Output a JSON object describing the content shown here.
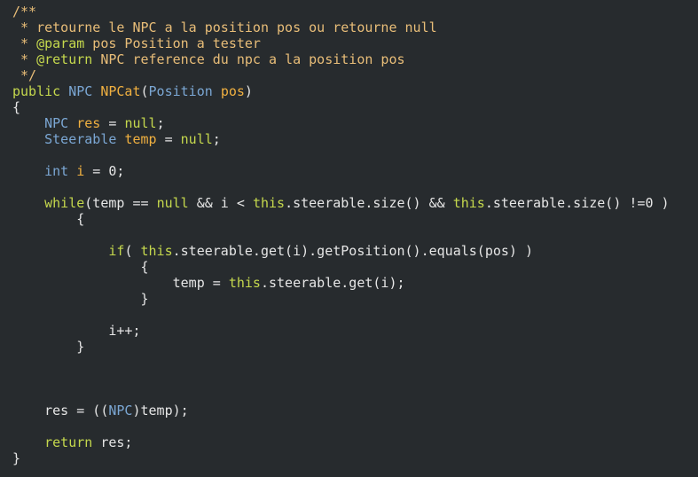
{
  "colors": {
    "background": "#272b2e",
    "default": "#e6e6e6",
    "comment": "#e8bd78",
    "keyword": "#c5d84d",
    "type": "#7ba7d4",
    "variable": "#f0b040"
  },
  "lines": [
    {
      "row": 0,
      "tokens": [
        {
          "t": "/**",
          "k": "comment"
        }
      ]
    },
    {
      "row": 1,
      "tokens": [
        {
          "t": " * retourne le NPC a la position pos ou retourne null",
          "k": "comment"
        }
      ]
    },
    {
      "row": 2,
      "tokens": [
        {
          "t": " * ",
          "k": "comment"
        },
        {
          "t": "@param",
          "k": "keyword"
        },
        {
          "t": " pos Position a tester",
          "k": "comment"
        }
      ]
    },
    {
      "row": 3,
      "tokens": [
        {
          "t": " * ",
          "k": "comment"
        },
        {
          "t": "@return",
          "k": "keyword"
        },
        {
          "t": " NPC reference du npc a la position pos",
          "k": "comment"
        }
      ]
    },
    {
      "row": 4,
      "tokens": [
        {
          "t": " */",
          "k": "comment"
        }
      ]
    },
    {
      "row": 5,
      "tokens": [
        {
          "t": "public",
          "k": "keyword"
        },
        {
          "t": " ",
          "k": "default"
        },
        {
          "t": "NPC",
          "k": "type"
        },
        {
          "t": " ",
          "k": "default"
        },
        {
          "t": "NPCat",
          "k": "variable"
        },
        {
          "t": "(",
          "k": "default"
        },
        {
          "t": "Position",
          "k": "type"
        },
        {
          "t": " ",
          "k": "default"
        },
        {
          "t": "pos",
          "k": "variable"
        },
        {
          "t": ")",
          "k": "default"
        }
      ]
    },
    {
      "row": 6,
      "tokens": [
        {
          "t": "{",
          "k": "default"
        }
      ]
    },
    {
      "row": 7,
      "tokens": [
        {
          "t": "    ",
          "k": "default"
        },
        {
          "t": "NPC",
          "k": "type"
        },
        {
          "t": " ",
          "k": "default"
        },
        {
          "t": "res",
          "k": "variable"
        },
        {
          "t": " = ",
          "k": "default"
        },
        {
          "t": "null",
          "k": "keyword"
        },
        {
          "t": ";",
          "k": "default"
        }
      ]
    },
    {
      "row": 8,
      "tokens": [
        {
          "t": "    ",
          "k": "default"
        },
        {
          "t": "Steerable",
          "k": "type"
        },
        {
          "t": " ",
          "k": "default"
        },
        {
          "t": "temp",
          "k": "variable"
        },
        {
          "t": " = ",
          "k": "default"
        },
        {
          "t": "null",
          "k": "keyword"
        },
        {
          "t": ";",
          "k": "default"
        }
      ]
    },
    {
      "row": 10,
      "tokens": [
        {
          "t": "    ",
          "k": "default"
        },
        {
          "t": "int",
          "k": "type"
        },
        {
          "t": " ",
          "k": "default"
        },
        {
          "t": "i",
          "k": "variable"
        },
        {
          "t": " = 0;",
          "k": "default"
        }
      ]
    },
    {
      "row": 12,
      "tokens": [
        {
          "t": "    ",
          "k": "default"
        },
        {
          "t": "while",
          "k": "keyword"
        },
        {
          "t": "(temp == ",
          "k": "default"
        },
        {
          "t": "null",
          "k": "keyword"
        },
        {
          "t": " && i < ",
          "k": "default"
        },
        {
          "t": "this",
          "k": "keyword"
        },
        {
          "t": ".steerable.size() && ",
          "k": "default"
        },
        {
          "t": "this",
          "k": "keyword"
        },
        {
          "t": ".steerable.size() !=0 )",
          "k": "default"
        }
      ]
    },
    {
      "row": 13,
      "tokens": [
        {
          "t": "        {",
          "k": "default"
        }
      ]
    },
    {
      "row": 15,
      "tokens": [
        {
          "t": "            ",
          "k": "default"
        },
        {
          "t": "if",
          "k": "keyword"
        },
        {
          "t": "( ",
          "k": "default"
        },
        {
          "t": "this",
          "k": "keyword"
        },
        {
          "t": ".steerable.get(i).getPosition().equals(pos) )",
          "k": "default"
        }
      ]
    },
    {
      "row": 16,
      "tokens": [
        {
          "t": "                {",
          "k": "default"
        }
      ]
    },
    {
      "row": 17,
      "tokens": [
        {
          "t": "                    temp = ",
          "k": "default"
        },
        {
          "t": "this",
          "k": "keyword"
        },
        {
          "t": ".steerable.get(i);",
          "k": "default"
        }
      ]
    },
    {
      "row": 18,
      "tokens": [
        {
          "t": "                }",
          "k": "default"
        }
      ]
    },
    {
      "row": 20,
      "tokens": [
        {
          "t": "            i++;",
          "k": "default"
        }
      ]
    },
    {
      "row": 21,
      "tokens": [
        {
          "t": "        }",
          "k": "default"
        }
      ]
    },
    {
      "row": 25,
      "tokens": [
        {
          "t": "    res = ((",
          "k": "default"
        },
        {
          "t": "NPC",
          "k": "type"
        },
        {
          "t": ")temp);",
          "k": "default"
        }
      ]
    },
    {
      "row": 27,
      "tokens": [
        {
          "t": "    ",
          "k": "default"
        },
        {
          "t": "return",
          "k": "keyword"
        },
        {
          "t": " res;",
          "k": "default"
        }
      ]
    },
    {
      "row": 28,
      "tokens": [
        {
          "t": "}",
          "k": "default"
        }
      ]
    }
  ]
}
